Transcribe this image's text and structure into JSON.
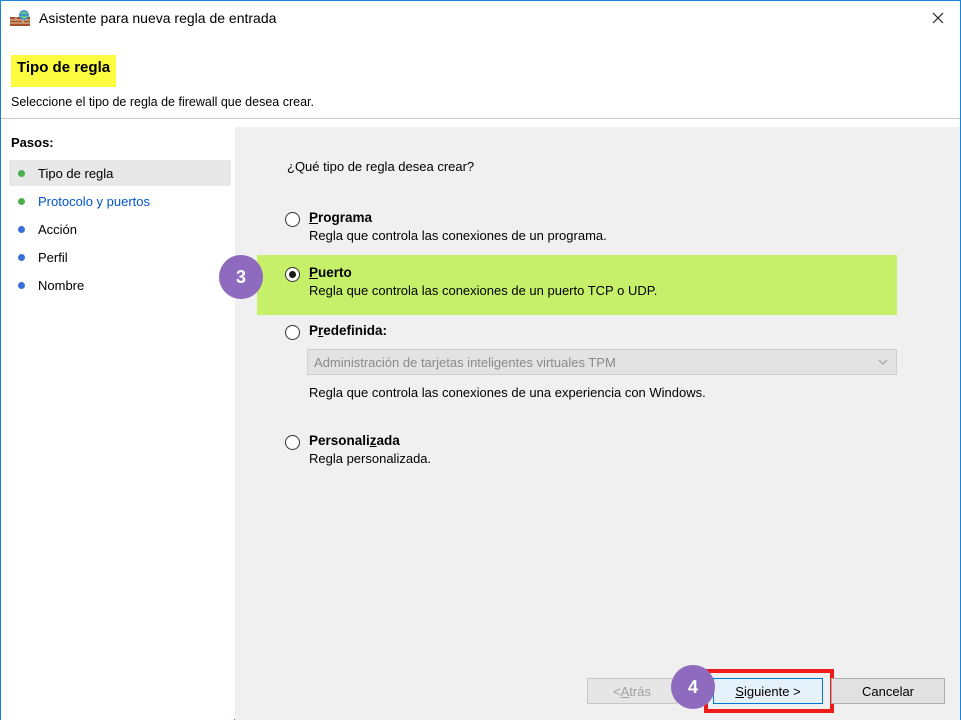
{
  "window": {
    "title": "Asistente para nueva regla de entrada",
    "close_glyph": "×"
  },
  "header": {
    "title": "Tipo de regla",
    "subtitle": "Seleccione el tipo de regla de firewall que desea crear.",
    "title_highlight_color": "#fdfd3f"
  },
  "sidebar": {
    "title": "Pasos:",
    "steps": [
      {
        "label": "Tipo de regla",
        "dot_color": "#4caf50",
        "state": "current"
      },
      {
        "label": "Protocolo y puertos",
        "dot_color": "#4caf50",
        "state": "link"
      },
      {
        "label": "Acción",
        "dot_color": "#3a6fd8",
        "state": "pending"
      },
      {
        "label": "Perfil",
        "dot_color": "#3a6fd8",
        "state": "pending"
      },
      {
        "label": "Nombre",
        "dot_color": "#3a6fd8",
        "state": "pending"
      }
    ]
  },
  "main": {
    "question": "¿Qué tipo de regla desea crear?",
    "options": [
      {
        "title_mnemonic": "P",
        "title_rest": "rograma",
        "description": "Regla que controla las conexiones de un programa.",
        "checked": false
      },
      {
        "title_mnemonic": "P",
        "title_rest": "uerto",
        "description": "Regla que controla las conexiones de un puerto TCP o UDP.",
        "checked": true
      },
      {
        "title_pre": "P",
        "title_mnemonic": "r",
        "title_rest": "edefinida:",
        "description": "Regla que controla las conexiones de una experiencia con Windows.",
        "checked": false
      },
      {
        "title_pre": "Personali",
        "title_mnemonic": "z",
        "title_rest": "ada",
        "description": "Regla personalizada.",
        "checked": false
      }
    ],
    "predefined_combo": {
      "value": "Administración de tarjetas inteligentes virtuales TPM"
    },
    "selected_highlight_color": "#c6f06a"
  },
  "annotations": {
    "badge_3": "3",
    "badge_4": "4",
    "badge_color": "#8e6bbf",
    "frame_color": "#ef1b1b"
  },
  "buttons": {
    "back_prefix": "< ",
    "back_mnemonic": "A",
    "back_rest": "trás",
    "next_mnemonic": "S",
    "next_rest": "iguiente >",
    "cancel": "Cancelar"
  }
}
